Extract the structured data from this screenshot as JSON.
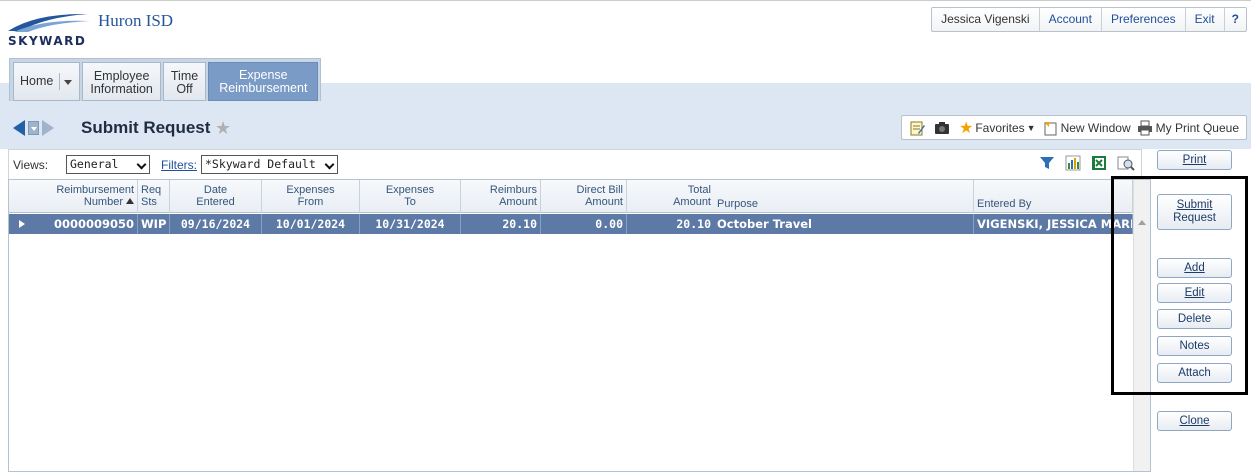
{
  "header": {
    "logo_text": "SKYWARD",
    "district": "Huron ISD",
    "user_name": "Jessica Vigenski",
    "menu": [
      "Account",
      "Preferences",
      "Exit"
    ],
    "help": "?"
  },
  "tabs": [
    {
      "label": "Home"
    },
    {
      "label": "Employee\nInformation"
    },
    {
      "label": "Time\nOff"
    },
    {
      "label": "Expense\nReimbursement",
      "active": true
    }
  ],
  "titlebar": {
    "title": "Submit Request",
    "toolbar": {
      "favorites": "Favorites",
      "new_window": "New Window",
      "print_queue": "My Print Queue"
    }
  },
  "views": {
    "views_label": "Views:",
    "views_value": "General",
    "filters_label": "Filters:",
    "filters_value": "*Skyward Default"
  },
  "grid": {
    "columns": [
      "Reimbursement Number",
      "Req Sts",
      "Date Entered",
      "Expenses From",
      "Expenses To",
      "Reimburs Amount",
      "Direct Bill Amount",
      "Total Amount",
      "Purpose",
      "Entered By"
    ],
    "col_lines": {
      "c0a": "Reimbursement",
      "c0b": "Number",
      "c1a": "Req",
      "c1b": "Sts",
      "c2a": "Date",
      "c2b": "Entered",
      "c3a": "Expenses",
      "c3b": "From",
      "c4a": "Expenses",
      "c4b": "To",
      "c5a": "Reimburs",
      "c5b": "Amount",
      "c6a": "Direct Bill",
      "c6b": "Amount",
      "c7a": "Total",
      "c7b": "Amount",
      "c8": "Purpose",
      "c9": "Entered By"
    },
    "rows": [
      {
        "number": "0000009050",
        "status": "WIP",
        "date_entered": "09/16/2024",
        "exp_from": "10/01/2024",
        "exp_to": "10/31/2024",
        "reimburs": "20.10",
        "direct_bill": "0.00",
        "total": "20.10",
        "purpose": "October Travel",
        "entered_by": "VIGENSKI, JESSICA MARIE"
      }
    ]
  },
  "actions": {
    "print": "Print",
    "submit_1": "Submit",
    "submit_2": "Request",
    "add": "Add",
    "edit": "Edit",
    "delete": "Delete",
    "notes": "Notes",
    "attach": "Attach",
    "clone": "Clone"
  },
  "colors": {
    "selected_row": "#5d7aa6",
    "active_tab": "#7a9bc6",
    "title_band": "#dce7f3",
    "link": "#1f4f9a"
  }
}
